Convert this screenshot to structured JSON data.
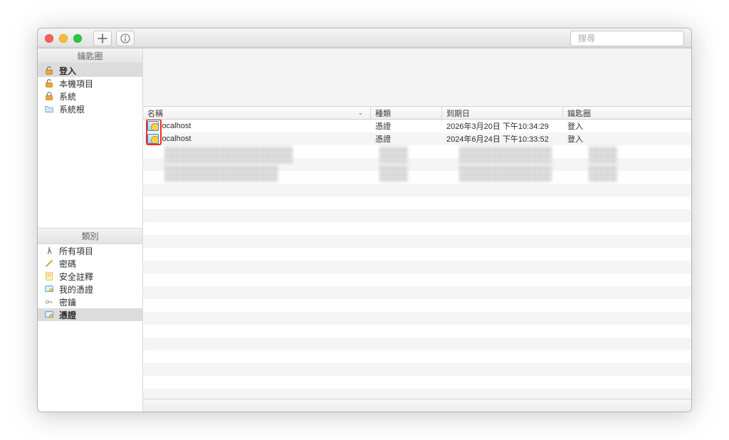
{
  "search": {
    "placeholder": "搜尋"
  },
  "sidebar_top": {
    "title": "鑰匙圈",
    "items": [
      {
        "label": "登入",
        "key": "login",
        "icon": "unlock",
        "selected": true
      },
      {
        "label": "本機項目",
        "key": "local-items",
        "icon": "unlock",
        "selected": false
      },
      {
        "label": "系統",
        "key": "system",
        "icon": "lock",
        "selected": false
      },
      {
        "label": "系統根",
        "key": "system-roots",
        "icon": "folder",
        "selected": false
      }
    ]
  },
  "sidebar_bottom": {
    "title": "類別",
    "items": [
      {
        "label": "所有項目",
        "key": "all",
        "icon": "compass",
        "selected": false
      },
      {
        "label": "密碼",
        "key": "passwords",
        "icon": "wand",
        "selected": false
      },
      {
        "label": "安全註釋",
        "key": "notes",
        "icon": "note",
        "selected": false
      },
      {
        "label": "我的憑證",
        "key": "my-certs",
        "icon": "cert",
        "selected": false
      },
      {
        "label": "密鑰",
        "key": "keys",
        "icon": "key",
        "selected": false
      },
      {
        "label": "憑證",
        "key": "certs",
        "icon": "cert",
        "selected": true
      }
    ]
  },
  "columns": {
    "name": "名稱",
    "kind": "種類",
    "date": "到期日",
    "chain": "鑰匙圈"
  },
  "rows": [
    {
      "name": "localhost",
      "kind": "憑證",
      "date": "2026年3月20日 下午10:34:29",
      "chain": "登入"
    },
    {
      "name": "localhost",
      "kind": "憑證",
      "date": "2024年6月24日 下午10:33:52",
      "chain": "登入"
    }
  ]
}
